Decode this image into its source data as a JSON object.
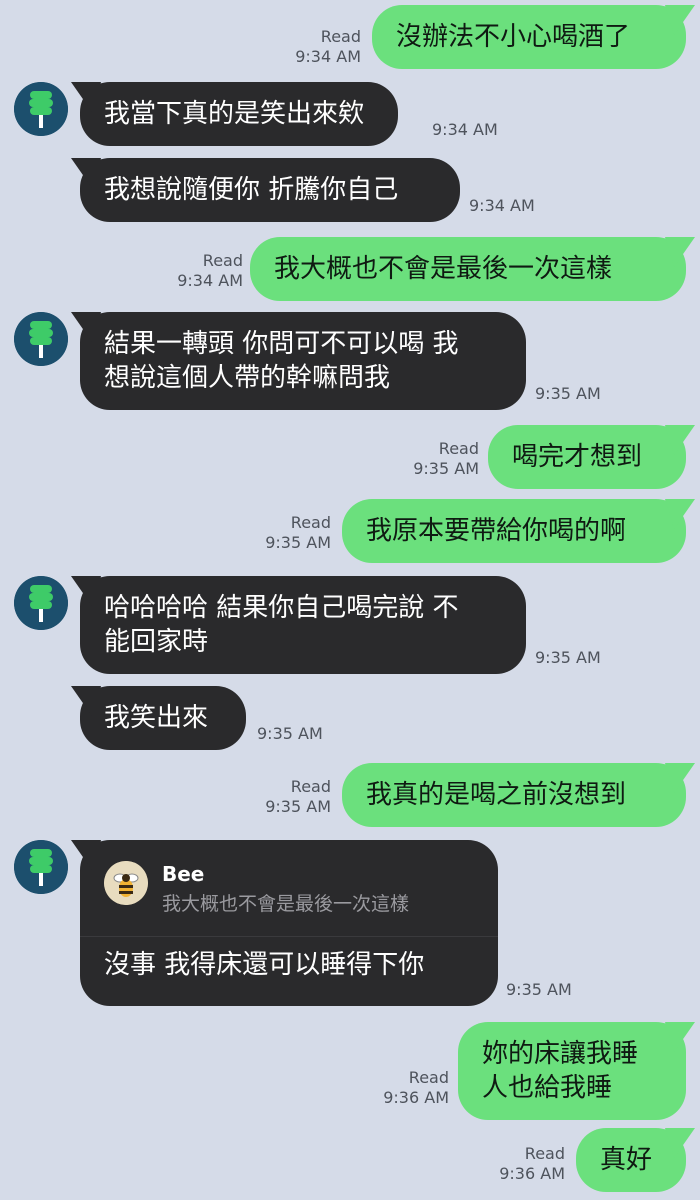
{
  "chat": {
    "read_label": "Read",
    "messages": [
      {
        "dir": "out",
        "text": "沒辦法不小心喝酒了",
        "time": "9:34 AM",
        "read": true
      },
      {
        "dir": "in",
        "text": "我當下真的是笑出來欸",
        "time": "9:34 AM",
        "avatar": true
      },
      {
        "dir": "in",
        "text": "我想說隨便你 折騰你自己",
        "time": "9:34 AM"
      },
      {
        "dir": "out",
        "text": "我大概也不會是最後一次這樣",
        "time": "9:34 AM",
        "read": true
      },
      {
        "dir": "in",
        "text": "結果一轉頭 你問可不可以喝 我\n想說這個人帶的幹嘛問我",
        "time": "9:35 AM",
        "avatar": true
      },
      {
        "dir": "out",
        "text": "喝完才想到",
        "time": "9:35 AM",
        "read": true
      },
      {
        "dir": "out",
        "text": "我原本要帶給你喝的啊",
        "time": "9:35 AM",
        "read": true
      },
      {
        "dir": "in",
        "text": "哈哈哈哈 結果你自己喝完說 不\n能回家時",
        "time": "9:35 AM",
        "avatar": true
      },
      {
        "dir": "in",
        "text": "我笑出來",
        "time": "9:35 AM"
      },
      {
        "dir": "out",
        "text": "我真的是喝之前沒想到",
        "time": "9:35 AM",
        "read": true
      },
      {
        "dir": "in",
        "text": "沒事 我得床還可以睡得下你",
        "time": "9:35 AM",
        "avatar": true,
        "reply": {
          "name": "Bee",
          "quote": "我大概也不會是最後一次這樣"
        }
      },
      {
        "dir": "out",
        "text": "妳的床讓我睡\n人也給我睡",
        "time": "9:36 AM",
        "read": true
      },
      {
        "dir": "out",
        "text": "真好",
        "time": "9:36 AM",
        "read": true
      }
    ]
  },
  "colors": {
    "background": "#d5dbe8",
    "outgoing_bubble": "#6be07d",
    "incoming_bubble": "#2a2a2c",
    "avatar": "#1c4f6d"
  },
  "icons": {
    "contact_avatar": "green-tree-icon",
    "reply_avatar": "bee-icon"
  }
}
